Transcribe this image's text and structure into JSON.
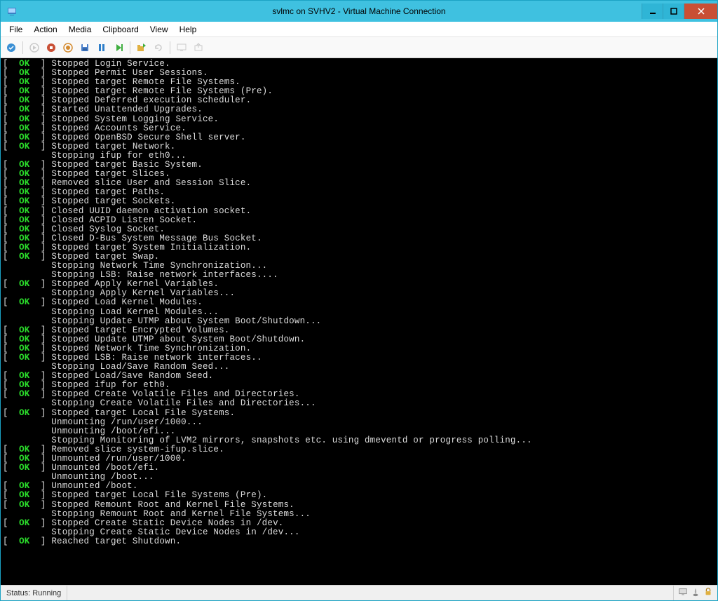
{
  "window": {
    "title": "svlmc on SVHV2 - Virtual Machine Connection"
  },
  "menu": {
    "items": [
      "File",
      "Action",
      "Media",
      "Clipboard",
      "View",
      "Help"
    ]
  },
  "toolbar": {
    "icons": [
      "ctrl-alt-del",
      "start",
      "turn-off",
      "shutdown",
      "save",
      "pause",
      "reset",
      "checkpoint",
      "revert",
      "enhanced-session",
      "share"
    ]
  },
  "status": {
    "text": "Status: Running"
  },
  "terminal": {
    "lines": [
      {
        "status": "OK",
        "msg": "Stopped Login Service."
      },
      {
        "status": "OK",
        "msg": "Stopped Permit User Sessions."
      },
      {
        "status": "OK",
        "msg": "Stopped target Remote File Systems."
      },
      {
        "status": "OK",
        "msg": "Stopped target Remote File Systems (Pre)."
      },
      {
        "status": "OK",
        "msg": "Stopped Deferred execution scheduler."
      },
      {
        "status": "OK",
        "msg": "Started Unattended Upgrades."
      },
      {
        "status": "OK",
        "msg": "Stopped System Logging Service."
      },
      {
        "status": "OK",
        "msg": "Stopped Accounts Service."
      },
      {
        "status": "OK",
        "msg": "Stopped OpenBSD Secure Shell server."
      },
      {
        "status": "OK",
        "msg": "Stopped target Network."
      },
      {
        "status": "",
        "msg": "Stopping ifup for eth0..."
      },
      {
        "status": "OK",
        "msg": "Stopped target Basic System."
      },
      {
        "status": "OK",
        "msg": "Stopped target Slices."
      },
      {
        "status": "OK",
        "msg": "Removed slice User and Session Slice."
      },
      {
        "status": "OK",
        "msg": "Stopped target Paths."
      },
      {
        "status": "OK",
        "msg": "Stopped target Sockets."
      },
      {
        "status": "OK",
        "msg": "Closed UUID daemon activation socket."
      },
      {
        "status": "OK",
        "msg": "Closed ACPID Listen Socket."
      },
      {
        "status": "OK",
        "msg": "Closed Syslog Socket."
      },
      {
        "status": "OK",
        "msg": "Closed D-Bus System Message Bus Socket."
      },
      {
        "status": "OK",
        "msg": "Stopped target System Initialization."
      },
      {
        "status": "OK",
        "msg": "Stopped target Swap."
      },
      {
        "status": "",
        "msg": "Stopping Network Time Synchronization..."
      },
      {
        "status": "",
        "msg": "Stopping LSB: Raise network interfaces...."
      },
      {
        "status": "OK",
        "msg": "Stopped Apply Kernel Variables."
      },
      {
        "status": "",
        "msg": "Stopping Apply Kernel Variables..."
      },
      {
        "status": "OK",
        "msg": "Stopped Load Kernel Modules."
      },
      {
        "status": "",
        "msg": "Stopping Load Kernel Modules..."
      },
      {
        "status": "",
        "msg": "Stopping Update UTMP about System Boot/Shutdown..."
      },
      {
        "status": "OK",
        "msg": "Stopped target Encrypted Volumes."
      },
      {
        "status": "OK",
        "msg": "Stopped Update UTMP about System Boot/Shutdown."
      },
      {
        "status": "OK",
        "msg": "Stopped Network Time Synchronization."
      },
      {
        "status": "OK",
        "msg": "Stopped LSB: Raise network interfaces.."
      },
      {
        "status": "",
        "msg": "Stopping Load/Save Random Seed..."
      },
      {
        "status": "OK",
        "msg": "Stopped Load/Save Random Seed."
      },
      {
        "status": "OK",
        "msg": "Stopped ifup for eth0."
      },
      {
        "status": "OK",
        "msg": "Stopped Create Volatile Files and Directories."
      },
      {
        "status": "",
        "msg": "Stopping Create Volatile Files and Directories..."
      },
      {
        "status": "OK",
        "msg": "Stopped target Local File Systems."
      },
      {
        "status": "",
        "msg": "Unmounting /run/user/1000..."
      },
      {
        "status": "",
        "msg": "Unmounting /boot/efi..."
      },
      {
        "status": "",
        "msg": "Stopping Monitoring of LVM2 mirrors, snapshots etc. using dmeventd or progress polling..."
      },
      {
        "status": "OK",
        "msg": "Removed slice system-ifup.slice."
      },
      {
        "status": "OK",
        "msg": "Unmounted /run/user/1000."
      },
      {
        "status": "OK",
        "msg": "Unmounted /boot/efi."
      },
      {
        "status": "",
        "msg": "Unmounting /boot..."
      },
      {
        "status": "OK",
        "msg": "Unmounted /boot."
      },
      {
        "status": "OK",
        "msg": "Stopped target Local File Systems (Pre)."
      },
      {
        "status": "OK",
        "msg": "Stopped Remount Root and Kernel File Systems."
      },
      {
        "status": "",
        "msg": "Stopping Remount Root and Kernel File Systems..."
      },
      {
        "status": "OK",
        "msg": "Stopped Create Static Device Nodes in /dev."
      },
      {
        "status": "",
        "msg": "Stopping Create Static Device Nodes in /dev..."
      },
      {
        "status": "OK",
        "msg": "Reached target Shutdown."
      }
    ]
  }
}
